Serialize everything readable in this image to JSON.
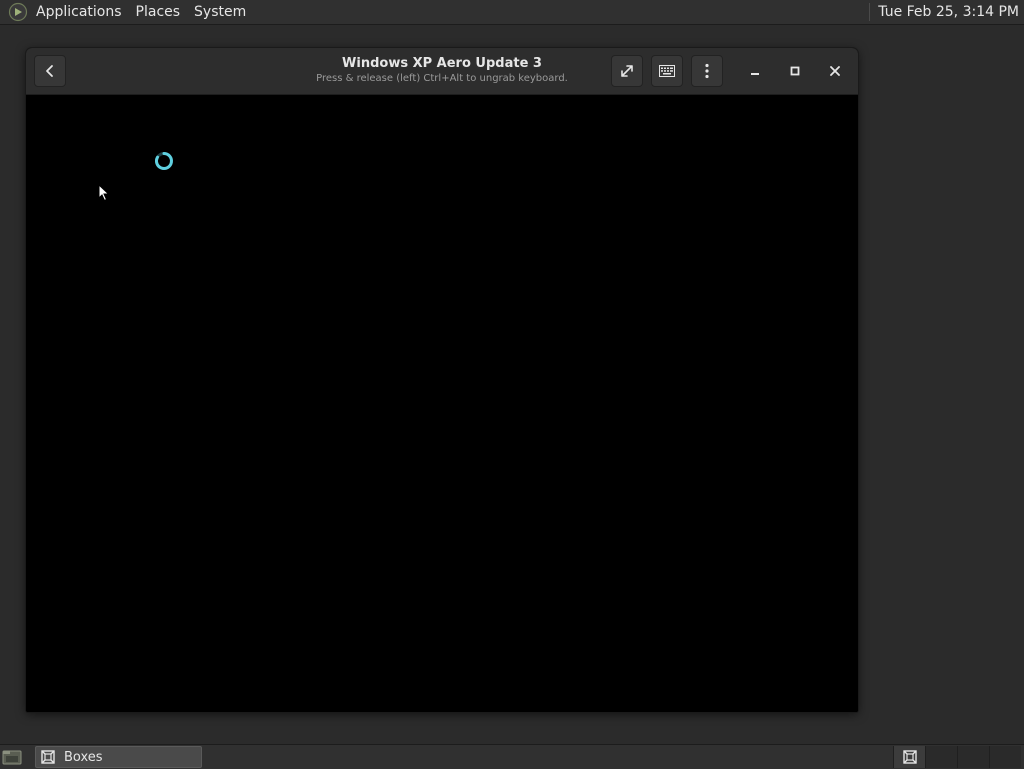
{
  "top_panel": {
    "menus": [
      "Applications",
      "Places",
      "System"
    ],
    "clock": "Tue Feb 25,  3:14 PM",
    "logo_icon": "mint-logo-icon"
  },
  "window": {
    "title": "Windows XP Aero Update 3",
    "subtitle": "Press & release (left) Ctrl+Alt to ungrab keyboard.",
    "buttons": {
      "back": "back-arrow-icon",
      "fullscreen": "fullscreen-icon",
      "keyboard": "keyboard-icon",
      "menu": "vertical-dots-icon",
      "minimize": "minimize-icon",
      "maximize": "maximize-icon",
      "close": "close-icon"
    },
    "display": {
      "spinner_color": "#5fd0e0",
      "background": "#000000"
    }
  },
  "bottom_panel": {
    "task_label": "Boxes",
    "task_icon": "boxes-icon",
    "workspaces": 4,
    "active_workspace": 1
  },
  "colors": {
    "panel": "#303030",
    "desktop": "#2b2b2b",
    "headerbar": "#2d2d2d",
    "accent": "#5fd0e0"
  }
}
